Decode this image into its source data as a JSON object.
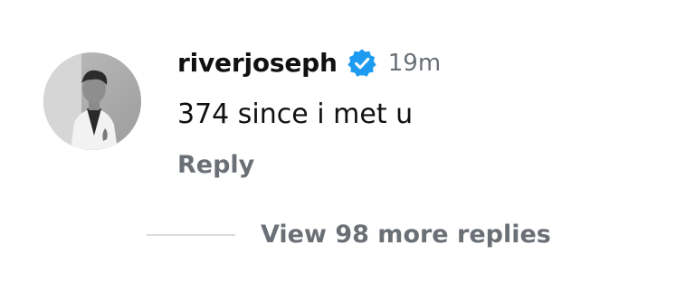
{
  "comment": {
    "username": "riverjoseph",
    "verified_icon": "verified-badge-icon",
    "verified_color": "#1d9bf0",
    "timestamp": "19m",
    "text": "374 since i met u",
    "reply_label": "Reply",
    "avatar_icon": "profile-avatar"
  },
  "replies": {
    "view_more_label": "View 98 more replies"
  }
}
